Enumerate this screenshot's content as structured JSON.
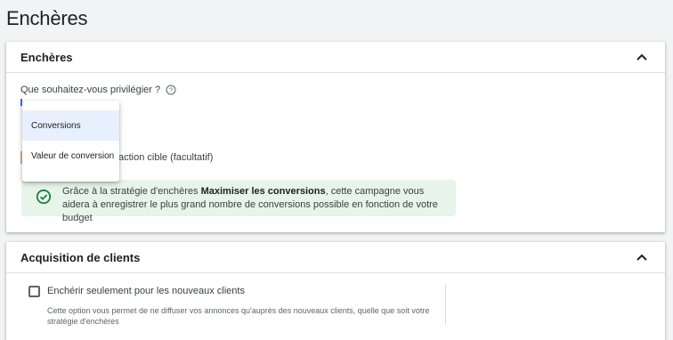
{
  "page": {
    "title": "Enchères"
  },
  "bidding": {
    "title": "Enchères",
    "question": "Que souhaitez-vous privilégier ?",
    "dropdown": {
      "options": [
        "Conversions",
        "Valeur de conversion"
      ],
      "highlighted": "Conversions"
    },
    "target_label": "action cible (facultatif)",
    "info": {
      "before": "Grâce à la stratégie d'enchères ",
      "bold": "Maximiser les conversions",
      "after": ", cette campagne vous aidera à enregistrer le plus grand nombre de conversions possible en fonction de votre budget"
    },
    "colors": {
      "info_bg": "#e6f4ea",
      "check_green": "#188038",
      "accent": "#1a73e8"
    }
  },
  "acquisition": {
    "title": "Acquisition de clients",
    "checkbox_label": "Enchérir seulement pour les nouveaux clients",
    "checked": false,
    "description": "Cette option vous permet de ne diffuser vos annonces qu'auprès des nouveaux clients, quelle que soit votre stratégie d'enchères"
  }
}
